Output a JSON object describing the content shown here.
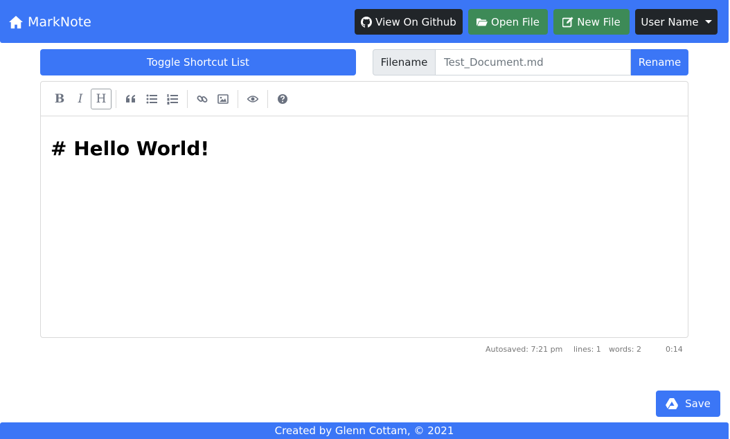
{
  "navbar": {
    "brand": "MarkNote",
    "buttons": {
      "github": "View On Github",
      "open_file": "Open File",
      "new_file": "New File",
      "user": "User Name"
    }
  },
  "controls": {
    "toggle_shortcuts": "Toggle Shortcut List",
    "filename_label": "Filename",
    "filename_value": "Test_Document.md",
    "rename": "Rename"
  },
  "editor": {
    "toolbar": [
      "bold",
      "italic",
      "heading",
      "quote",
      "unordered-list",
      "ordered-list",
      "link",
      "image",
      "preview",
      "guide"
    ],
    "bold_glyph": "B",
    "italic_glyph": "I",
    "heading_glyph": "H",
    "content": "# Hello World!"
  },
  "status": {
    "autosaved": "Autosaved: 7:21 pm",
    "lines": "lines: 1",
    "words": "words: 2",
    "cursor": "0:14"
  },
  "save_label": "Save",
  "footer": "Created by Glenn Cottam, © 2021",
  "colors": {
    "primary": "#3b76f6",
    "dark": "#212529",
    "success": "#3d8a57"
  }
}
